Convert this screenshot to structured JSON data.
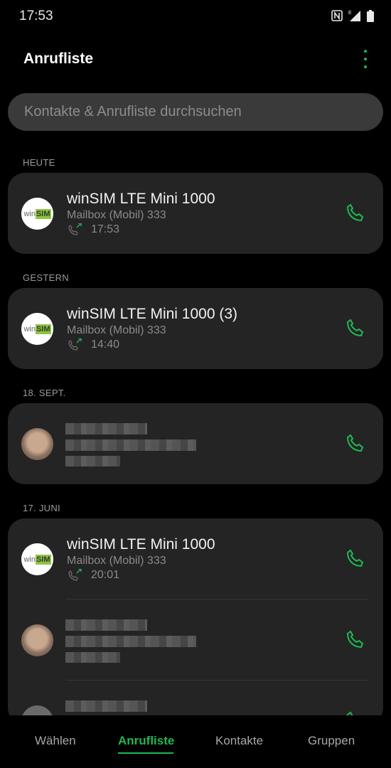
{
  "status_bar": {
    "time": "17:53",
    "network_label": "E"
  },
  "app_bar": {
    "title": "Anrufliste"
  },
  "search": {
    "placeholder": "Kontakte & Anrufliste durchsuchen"
  },
  "sections": [
    {
      "label": "HEUTE",
      "entries": [
        {
          "avatar_text_left": "win",
          "avatar_text_right": "SIM",
          "name": "winSIM LTE Mini 1000",
          "subtitle": "Mailbox (Mobil) 333",
          "time": "17:53",
          "direction": "outgoing"
        }
      ]
    },
    {
      "label": "GESTERN",
      "entries": [
        {
          "avatar_text_left": "win",
          "avatar_text_right": "SIM",
          "name": "winSIM LTE Mini 1000  (3)",
          "subtitle": "Mailbox (Mobil) 333",
          "time": "14:40",
          "direction": "outgoing"
        }
      ]
    },
    {
      "label": "18. SEPT.",
      "entries": [
        {
          "redacted": true
        }
      ]
    },
    {
      "label": "17. JUNI",
      "entries": [
        {
          "avatar_text_left": "win",
          "avatar_text_right": "SIM",
          "name": "winSIM LTE Mini 1000",
          "subtitle": "Mailbox (Mobil) 333",
          "time": "20:01",
          "direction": "outgoing"
        },
        {
          "redacted": true
        },
        {
          "redacted": true
        }
      ]
    }
  ],
  "bottom_nav": {
    "items": [
      {
        "label": "Wählen"
      },
      {
        "label": "Anrufliste",
        "active": true
      },
      {
        "label": "Kontakte"
      },
      {
        "label": "Gruppen"
      }
    ]
  },
  "colors": {
    "accent": "#1db954",
    "background": "#000000",
    "card": "#242424",
    "search": "#3a3a3a"
  },
  "icons": {
    "call": "phone-icon",
    "outgoing": "outgoing-call-icon",
    "menu": "more-vert-icon",
    "nfc": "nfc-icon",
    "signal": "signal-icon",
    "battery": "battery-icon"
  }
}
